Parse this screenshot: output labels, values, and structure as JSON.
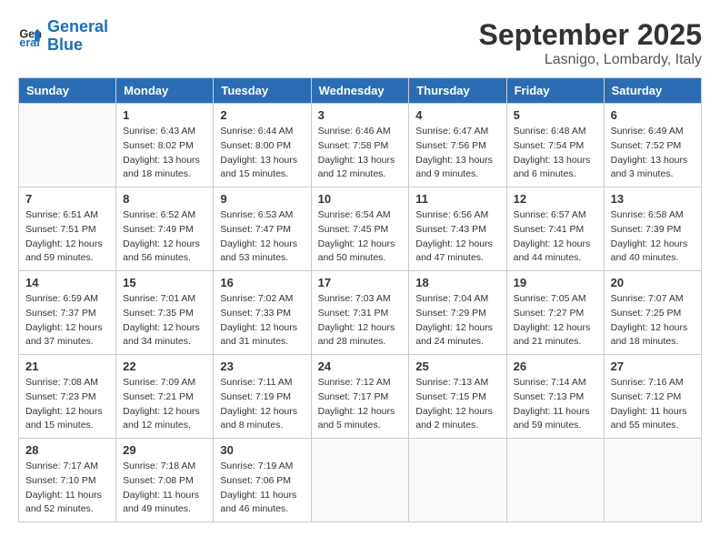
{
  "header": {
    "logo_line1": "General",
    "logo_line2": "Blue",
    "month_title": "September 2025",
    "location": "Lasnigo, Lombardy, Italy"
  },
  "days_of_week": [
    "Sunday",
    "Monday",
    "Tuesday",
    "Wednesday",
    "Thursday",
    "Friday",
    "Saturday"
  ],
  "weeks": [
    [
      {
        "day": "",
        "info": ""
      },
      {
        "day": "1",
        "info": "Sunrise: 6:43 AM\nSunset: 8:02 PM\nDaylight: 13 hours\nand 18 minutes."
      },
      {
        "day": "2",
        "info": "Sunrise: 6:44 AM\nSunset: 8:00 PM\nDaylight: 13 hours\nand 15 minutes."
      },
      {
        "day": "3",
        "info": "Sunrise: 6:46 AM\nSunset: 7:58 PM\nDaylight: 13 hours\nand 12 minutes."
      },
      {
        "day": "4",
        "info": "Sunrise: 6:47 AM\nSunset: 7:56 PM\nDaylight: 13 hours\nand 9 minutes."
      },
      {
        "day": "5",
        "info": "Sunrise: 6:48 AM\nSunset: 7:54 PM\nDaylight: 13 hours\nand 6 minutes."
      },
      {
        "day": "6",
        "info": "Sunrise: 6:49 AM\nSunset: 7:52 PM\nDaylight: 13 hours\nand 3 minutes."
      }
    ],
    [
      {
        "day": "7",
        "info": "Sunrise: 6:51 AM\nSunset: 7:51 PM\nDaylight: 12 hours\nand 59 minutes."
      },
      {
        "day": "8",
        "info": "Sunrise: 6:52 AM\nSunset: 7:49 PM\nDaylight: 12 hours\nand 56 minutes."
      },
      {
        "day": "9",
        "info": "Sunrise: 6:53 AM\nSunset: 7:47 PM\nDaylight: 12 hours\nand 53 minutes."
      },
      {
        "day": "10",
        "info": "Sunrise: 6:54 AM\nSunset: 7:45 PM\nDaylight: 12 hours\nand 50 minutes."
      },
      {
        "day": "11",
        "info": "Sunrise: 6:56 AM\nSunset: 7:43 PM\nDaylight: 12 hours\nand 47 minutes."
      },
      {
        "day": "12",
        "info": "Sunrise: 6:57 AM\nSunset: 7:41 PM\nDaylight: 12 hours\nand 44 minutes."
      },
      {
        "day": "13",
        "info": "Sunrise: 6:58 AM\nSunset: 7:39 PM\nDaylight: 12 hours\nand 40 minutes."
      }
    ],
    [
      {
        "day": "14",
        "info": "Sunrise: 6:59 AM\nSunset: 7:37 PM\nDaylight: 12 hours\nand 37 minutes."
      },
      {
        "day": "15",
        "info": "Sunrise: 7:01 AM\nSunset: 7:35 PM\nDaylight: 12 hours\nand 34 minutes."
      },
      {
        "day": "16",
        "info": "Sunrise: 7:02 AM\nSunset: 7:33 PM\nDaylight: 12 hours\nand 31 minutes."
      },
      {
        "day": "17",
        "info": "Sunrise: 7:03 AM\nSunset: 7:31 PM\nDaylight: 12 hours\nand 28 minutes."
      },
      {
        "day": "18",
        "info": "Sunrise: 7:04 AM\nSunset: 7:29 PM\nDaylight: 12 hours\nand 24 minutes."
      },
      {
        "day": "19",
        "info": "Sunrise: 7:05 AM\nSunset: 7:27 PM\nDaylight: 12 hours\nand 21 minutes."
      },
      {
        "day": "20",
        "info": "Sunrise: 7:07 AM\nSunset: 7:25 PM\nDaylight: 12 hours\nand 18 minutes."
      }
    ],
    [
      {
        "day": "21",
        "info": "Sunrise: 7:08 AM\nSunset: 7:23 PM\nDaylight: 12 hours\nand 15 minutes."
      },
      {
        "day": "22",
        "info": "Sunrise: 7:09 AM\nSunset: 7:21 PM\nDaylight: 12 hours\nand 12 minutes."
      },
      {
        "day": "23",
        "info": "Sunrise: 7:11 AM\nSunset: 7:19 PM\nDaylight: 12 hours\nand 8 minutes."
      },
      {
        "day": "24",
        "info": "Sunrise: 7:12 AM\nSunset: 7:17 PM\nDaylight: 12 hours\nand 5 minutes."
      },
      {
        "day": "25",
        "info": "Sunrise: 7:13 AM\nSunset: 7:15 PM\nDaylight: 12 hours\nand 2 minutes."
      },
      {
        "day": "26",
        "info": "Sunrise: 7:14 AM\nSunset: 7:13 PM\nDaylight: 11 hours\nand 59 minutes."
      },
      {
        "day": "27",
        "info": "Sunrise: 7:16 AM\nSunset: 7:12 PM\nDaylight: 11 hours\nand 55 minutes."
      }
    ],
    [
      {
        "day": "28",
        "info": "Sunrise: 7:17 AM\nSunset: 7:10 PM\nDaylight: 11 hours\nand 52 minutes."
      },
      {
        "day": "29",
        "info": "Sunrise: 7:18 AM\nSunset: 7:08 PM\nDaylight: 11 hours\nand 49 minutes."
      },
      {
        "day": "30",
        "info": "Sunrise: 7:19 AM\nSunset: 7:06 PM\nDaylight: 11 hours\nand 46 minutes."
      },
      {
        "day": "",
        "info": ""
      },
      {
        "day": "",
        "info": ""
      },
      {
        "day": "",
        "info": ""
      },
      {
        "day": "",
        "info": ""
      }
    ]
  ]
}
